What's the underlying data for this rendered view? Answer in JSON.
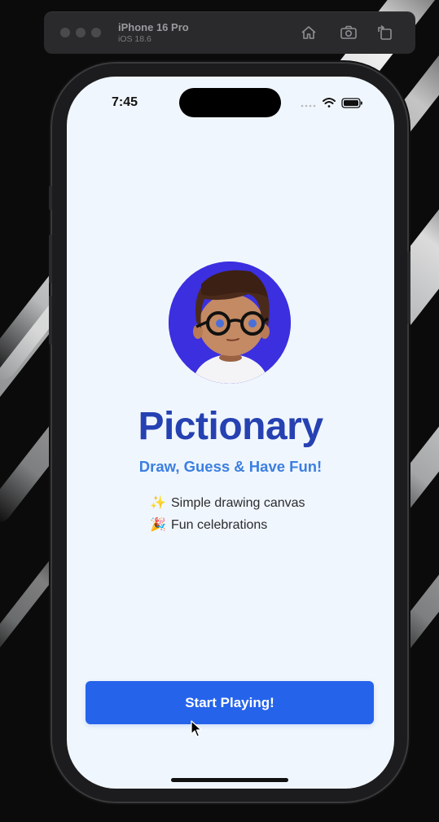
{
  "simulator": {
    "device_name": "iPhone 16 Pro",
    "os_version": "iOS 18.6"
  },
  "status_bar": {
    "time": "7:45"
  },
  "app": {
    "title": "Pictionary",
    "tagline": "Draw, Guess & Have Fun!",
    "features": [
      {
        "emoji": "✨",
        "text": "Simple drawing canvas"
      },
      {
        "emoji": "🎉",
        "text": "Fun celebrations"
      }
    ],
    "start_button_label": "Start Playing!"
  },
  "colors": {
    "title": "#2541b2",
    "tagline": "#3c7fe0",
    "button": "#2563eb",
    "screen_background": "#f0f6fd",
    "avatar_background": "#3b2fe0"
  }
}
